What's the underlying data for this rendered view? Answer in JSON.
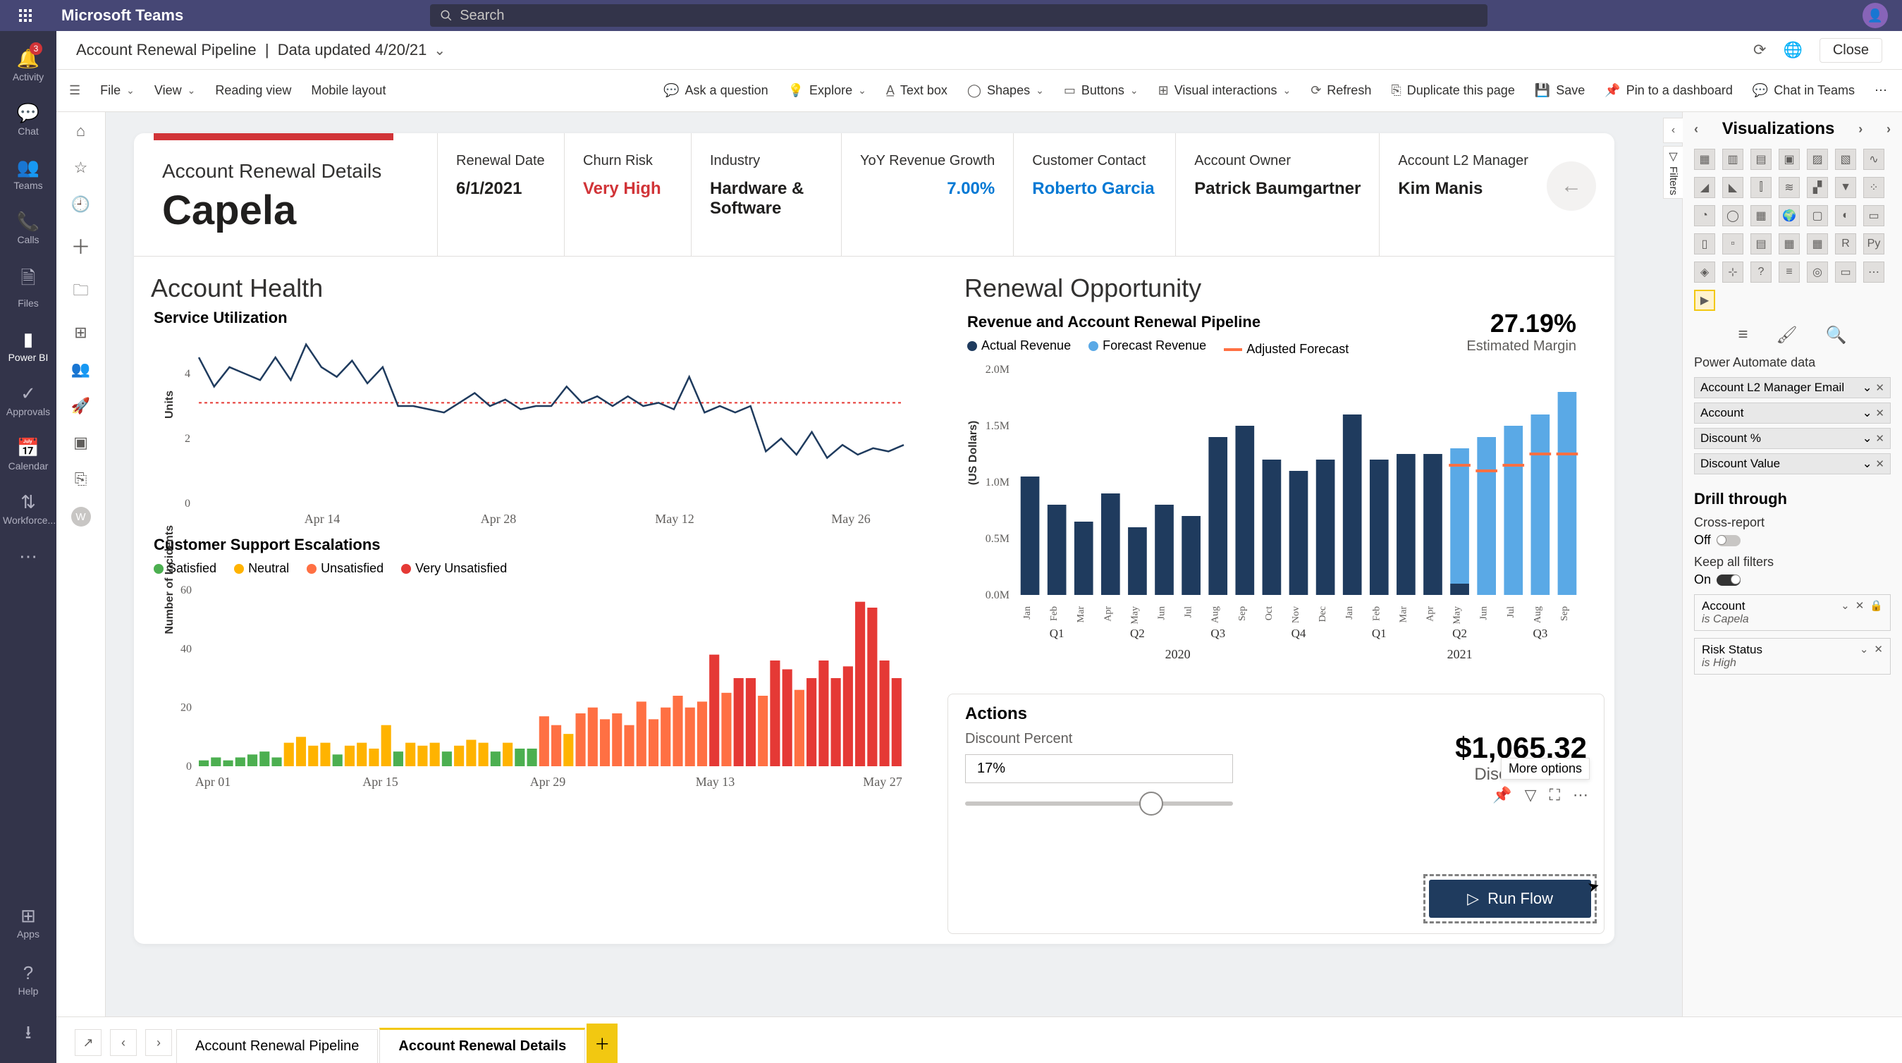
{
  "app": {
    "title": "Microsoft Teams",
    "search_placeholder": "Search"
  },
  "rail": {
    "activity": "Activity",
    "activity_badge": "3",
    "chat": "Chat",
    "teams": "Teams",
    "calls": "Calls",
    "files": "Files",
    "powerbi": "Power BI",
    "approvals": "Approvals",
    "calendar": "Calendar",
    "workforce": "Workforce...",
    "apps": "Apps",
    "help": "Help"
  },
  "header": {
    "title": "Account Renewal Pipeline",
    "subtitle": "Data updated 4/20/21",
    "close": "Close"
  },
  "ribbon": {
    "file": "File",
    "view": "View",
    "reading_view": "Reading view",
    "mobile": "Mobile layout",
    "ask": "Ask a question",
    "explore": "Explore",
    "textbox": "Text box",
    "shapes": "Shapes",
    "buttons": "Buttons",
    "visual_int": "Visual interactions",
    "refresh": "Refresh",
    "duplicate": "Duplicate this page",
    "save": "Save",
    "pin": "Pin to a dashboard",
    "chat": "Chat in Teams"
  },
  "account": {
    "details_label": "Account Renewal Details",
    "name": "Capela",
    "renewal_date_k": "Renewal Date",
    "renewal_date_v": "6/1/2021",
    "churn_k": "Churn Risk",
    "churn_v": "Very High",
    "industry_k": "Industry",
    "industry_v": "Hardware & Software",
    "yoy_k": "YoY Revenue Growth",
    "yoy_v": "7.00%",
    "contact_k": "Customer Contact",
    "contact_v": "Roberto Garcia",
    "owner_k": "Account Owner",
    "owner_v": "Patrick Baumgartner",
    "l2_k": "Account L2 Manager",
    "l2_v": "Kim Manis"
  },
  "health": {
    "title": "Account Health",
    "svc_sub": "Service Utilization",
    "svc_y": "Units",
    "esc_sub": "Customer Support Escalations",
    "esc_y": "Number of Incidents",
    "esc_legend": {
      "s": "Satisfied",
      "n": "Neutral",
      "u": "Unsatisfied",
      "vu": "Very Unsatisfied"
    }
  },
  "renewal": {
    "title": "Renewal Opportunity",
    "sub": "Revenue and Account Renewal Pipeline",
    "legend": {
      "actual": "Actual Revenue",
      "forecast": "Forecast Revenue",
      "adj": "Adjusted Forecast"
    },
    "margin_pct": "27.19%",
    "margin_lbl": "Estimated Margin",
    "y_label": "(US Dollars)"
  },
  "actions": {
    "title": "Actions",
    "dp_label": "Discount Percent",
    "dp_value": "17%",
    "dv_amount": "$1,065,32",
    "dv_label": "Discount Value",
    "more": "More options",
    "run": "Run Flow"
  },
  "viz_panel": {
    "title": "Visualizations",
    "pa_title": "Power Automate data",
    "fields": [
      "Account L2 Manager Email",
      "Account",
      "Discount %",
      "Discount Value"
    ],
    "drill_title": "Drill through",
    "cross": "Cross-report",
    "off": "Off",
    "keep": "Keep all filters",
    "on": "On",
    "drill1_name": "Account",
    "drill1_sub": "is Capela",
    "drill2_name": "Risk Status",
    "drill2_sub": "is High",
    "filters_tab": "Filters",
    "fields_tab": "Fields"
  },
  "tabs": {
    "t1": "Account Renewal Pipeline",
    "t2": "Account Renewal Details"
  },
  "chart_data": {
    "service_utilization": {
      "type": "line",
      "ylabel": "Units",
      "ylim": [
        0,
        5
      ],
      "x_ticks": [
        "Apr 14",
        "Apr 28",
        "May 12",
        "May 26"
      ],
      "threshold": 3.1,
      "values": [
        4.5,
        3.6,
        4.2,
        4.0,
        3.8,
        4.5,
        3.8,
        4.9,
        4.2,
        3.9,
        4.4,
        3.7,
        4.2,
        3.0,
        3.0,
        2.9,
        2.8,
        3.1,
        3.4,
        3.0,
        3.2,
        2.9,
        3.0,
        3.0,
        3.6,
        3.1,
        3.3,
        3.0,
        3.3,
        3.0,
        3.1,
        2.9,
        3.9,
        2.8,
        3.0,
        2.8,
        3.0,
        1.6,
        2.0,
        1.5,
        2.2,
        1.4,
        1.8,
        1.5,
        1.7,
        1.6,
        1.8
      ]
    },
    "escalations": {
      "type": "bar",
      "ylabel": "Number of Incidents",
      "ylim": [
        0,
        60
      ],
      "x_ticks": [
        "Apr 01",
        "Apr 15",
        "Apr 29",
        "May 13",
        "May 27"
      ],
      "series_colors": {
        "Satisfied": "#4caf50",
        "Neutral": "#ffb300",
        "Unsatisfied": "#ff7043",
        "Very Unsatisfied": "#e53935"
      },
      "bars": [
        {
          "s": "Satisfied",
          "v": 2
        },
        {
          "s": "Satisfied",
          "v": 3
        },
        {
          "s": "Satisfied",
          "v": 2
        },
        {
          "s": "Satisfied",
          "v": 3
        },
        {
          "s": "Satisfied",
          "v": 4
        },
        {
          "s": "Satisfied",
          "v": 5
        },
        {
          "s": "Satisfied",
          "v": 3
        },
        {
          "s": "Neutral",
          "v": 8
        },
        {
          "s": "Neutral",
          "v": 10
        },
        {
          "s": "Neutral",
          "v": 7
        },
        {
          "s": "Neutral",
          "v": 8
        },
        {
          "s": "Satisfied",
          "v": 4
        },
        {
          "s": "Neutral",
          "v": 7
        },
        {
          "s": "Neutral",
          "v": 8
        },
        {
          "s": "Neutral",
          "v": 6
        },
        {
          "s": "Neutral",
          "v": 14
        },
        {
          "s": "Satisfied",
          "v": 5
        },
        {
          "s": "Neutral",
          "v": 8
        },
        {
          "s": "Neutral",
          "v": 7
        },
        {
          "s": "Neutral",
          "v": 8
        },
        {
          "s": "Satisfied",
          "v": 5
        },
        {
          "s": "Neutral",
          "v": 7
        },
        {
          "s": "Neutral",
          "v": 9
        },
        {
          "s": "Neutral",
          "v": 8
        },
        {
          "s": "Satisfied",
          "v": 5
        },
        {
          "s": "Neutral",
          "v": 8
        },
        {
          "s": "Satisfied",
          "v": 6
        },
        {
          "s": "Satisfied",
          "v": 6
        },
        {
          "s": "Unsatisfied",
          "v": 17
        },
        {
          "s": "Unsatisfied",
          "v": 14
        },
        {
          "s": "Neutral",
          "v": 11
        },
        {
          "s": "Unsatisfied",
          "v": 18
        },
        {
          "s": "Unsatisfied",
          "v": 20
        },
        {
          "s": "Unsatisfied",
          "v": 16
        },
        {
          "s": "Unsatisfied",
          "v": 18
        },
        {
          "s": "Unsatisfied",
          "v": 14
        },
        {
          "s": "Unsatisfied",
          "v": 22
        },
        {
          "s": "Unsatisfied",
          "v": 16
        },
        {
          "s": "Unsatisfied",
          "v": 20
        },
        {
          "s": "Unsatisfied",
          "v": 24
        },
        {
          "s": "Unsatisfied",
          "v": 20
        },
        {
          "s": "Unsatisfied",
          "v": 22
        },
        {
          "s": "Very Unsatisfied",
          "v": 38
        },
        {
          "s": "Unsatisfied",
          "v": 25
        },
        {
          "s": "Very Unsatisfied",
          "v": 30
        },
        {
          "s": "Very Unsatisfied",
          "v": 30
        },
        {
          "s": "Unsatisfied",
          "v": 24
        },
        {
          "s": "Very Unsatisfied",
          "v": 36
        },
        {
          "s": "Very Unsatisfied",
          "v": 33
        },
        {
          "s": "Unsatisfied",
          "v": 26
        },
        {
          "s": "Very Unsatisfied",
          "v": 30
        },
        {
          "s": "Very Unsatisfied",
          "v": 36
        },
        {
          "s": "Very Unsatisfied",
          "v": 30
        },
        {
          "s": "Very Unsatisfied",
          "v": 34
        },
        {
          "s": "Very Unsatisfied",
          "v": 56
        },
        {
          "s": "Very Unsatisfied",
          "v": 54
        },
        {
          "s": "Very Unsatisfied",
          "v": 36
        },
        {
          "s": "Very Unsatisfied",
          "v": 30
        }
      ]
    },
    "revenue_pipeline": {
      "type": "bar",
      "ylabel": "(US Dollars)",
      "ylim": [
        0,
        2000000
      ],
      "y_ticks": [
        "0.0M",
        "0.5M",
        "1.0M",
        "1.5M",
        "2.0M"
      ],
      "months": [
        "Jan",
        "Feb",
        "Mar",
        "Apr",
        "May",
        "Jun",
        "Jul",
        "Aug",
        "Sep",
        "Oct",
        "Nov",
        "Dec",
        "Jan",
        "Feb",
        "Mar",
        "Apr",
        "May",
        "Jun",
        "Jul",
        "Aug",
        "Sep"
      ],
      "quarters_2020": [
        "Q1",
        "Q2",
        "Q3",
        "Q4"
      ],
      "quarters_2021": [
        "Q1",
        "Q2",
        "Q3"
      ],
      "series": [
        {
          "name": "Actual Revenue",
          "color": "#1f3b5e",
          "values": [
            1050000,
            800000,
            650000,
            900000,
            600000,
            800000,
            700000,
            1400000,
            1500000,
            1200000,
            1100000,
            1200000,
            1600000,
            1200000,
            1250000,
            1250000,
            100000,
            0,
            0,
            0,
            0
          ]
        },
        {
          "name": "Forecast Revenue",
          "color": "#5aa9e6",
          "values": [
            0,
            0,
            0,
            0,
            0,
            0,
            0,
            0,
            0,
            0,
            0,
            0,
            0,
            0,
            0,
            0,
            1300000,
            1400000,
            1500000,
            1600000,
            1800000
          ]
        }
      ],
      "adjusted_forecast": {
        "color": "#ff7043",
        "values": [
          null,
          null,
          null,
          null,
          null,
          null,
          null,
          null,
          null,
          null,
          null,
          null,
          null,
          null,
          null,
          null,
          1150000,
          1100000,
          1150000,
          1250000,
          1250000
        ]
      }
    }
  }
}
